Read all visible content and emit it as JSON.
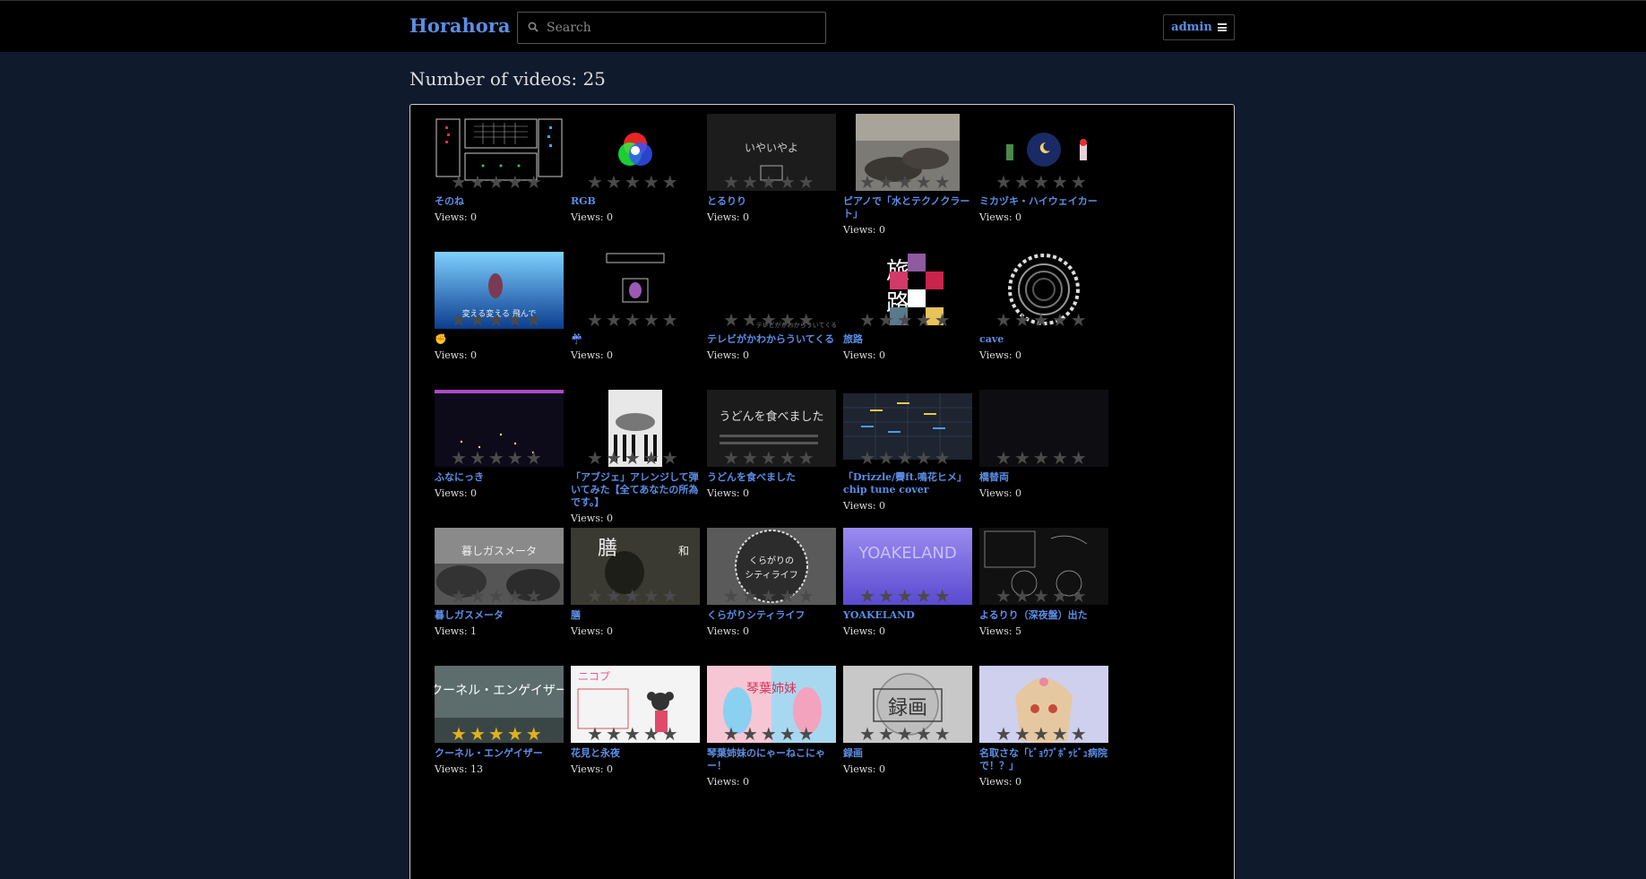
{
  "header": {
    "brand": "Horahora",
    "search_placeholder": "Search",
    "admin_label": "admin",
    "colors": {
      "brand": "#5b8ee6",
      "bar": "#000000",
      "page_bg": "#0f1a2d"
    }
  },
  "main": {
    "count_text": "Number of videos: 25",
    "views_prefix": "Views: "
  },
  "videos": [
    {
      "title": "そのね",
      "views": "0",
      "rating": 0
    },
    {
      "title": "RGB",
      "views": "0",
      "rating": 0
    },
    {
      "title": "とるりり",
      "views": "0",
      "rating": 0
    },
    {
      "title": "ピアノで「水とテクノクラート」",
      "views": "0",
      "rating": 0
    },
    {
      "title": "ミカヅキ・ハイウェイカー",
      "views": "0",
      "rating": 0
    },
    {
      "title": "✊",
      "views": "0",
      "rating": 0
    },
    {
      "title": "☔",
      "views": "0",
      "rating": 0
    },
    {
      "title": "テレビがかわからういてくる",
      "views": "0",
      "rating": 0
    },
    {
      "title": "旅路",
      "views": "0",
      "rating": 0
    },
    {
      "title": "cave",
      "views": "0",
      "rating": 0
    },
    {
      "title": "ふなにっき",
      "views": "0",
      "rating": 0
    },
    {
      "title": "「アブジェ」アレンジして弾いてみた【全てあなたの所為です。】",
      "views": "0",
      "rating": 0
    },
    {
      "title": "うどんを食べました",
      "views": "0",
      "rating": 0
    },
    {
      "title": "「Drizzle/霽ft.鳴花ヒメ」chip tune cover",
      "views": "0",
      "rating": 0
    },
    {
      "title": "橋替両",
      "views": "0",
      "rating": 0
    },
    {
      "title": "暮しガスメータ",
      "views": "1",
      "rating": 0
    },
    {
      "title": "膳",
      "views": "0",
      "rating": 0
    },
    {
      "title": "くらがりシティライフ",
      "views": "0",
      "rating": 0
    },
    {
      "title": "YOAKELAND",
      "views": "0",
      "rating": 0
    },
    {
      "title": "よるりり（深夜盤）出た",
      "views": "5",
      "rating": 0
    },
    {
      "title": "クーネル・エンゲイザー",
      "views": "13",
      "rating": 5
    },
    {
      "title": "花見と永夜",
      "views": "0",
      "rating": 0
    },
    {
      "title": "琴葉姉妹のにゃーねこにゃー！",
      "views": "0",
      "rating": 0
    },
    {
      "title": "録画",
      "views": "0",
      "rating": 0
    },
    {
      "title": "名取さな「ﾋﾞｮｳﾌﾞﾎﾞｯﾋﾞｭ病院で！？」",
      "views": "0",
      "rating": 0
    }
  ],
  "thumb_text": {
    "toruriri": "いやいやよ",
    "cave_no": "",
    "udon": "うどんを食べました",
    "yoakeland": "YOAKELAND",
    "kuragari": "くらがりシティライフ",
    "rokuga": "録画",
    "kuneru": "クーネル・エンゲイザー",
    "tabiji_a": "旅",
    "tabiji_b": "路",
    "zen": "膳",
    "sea": "変える変える 飛んで"
  }
}
